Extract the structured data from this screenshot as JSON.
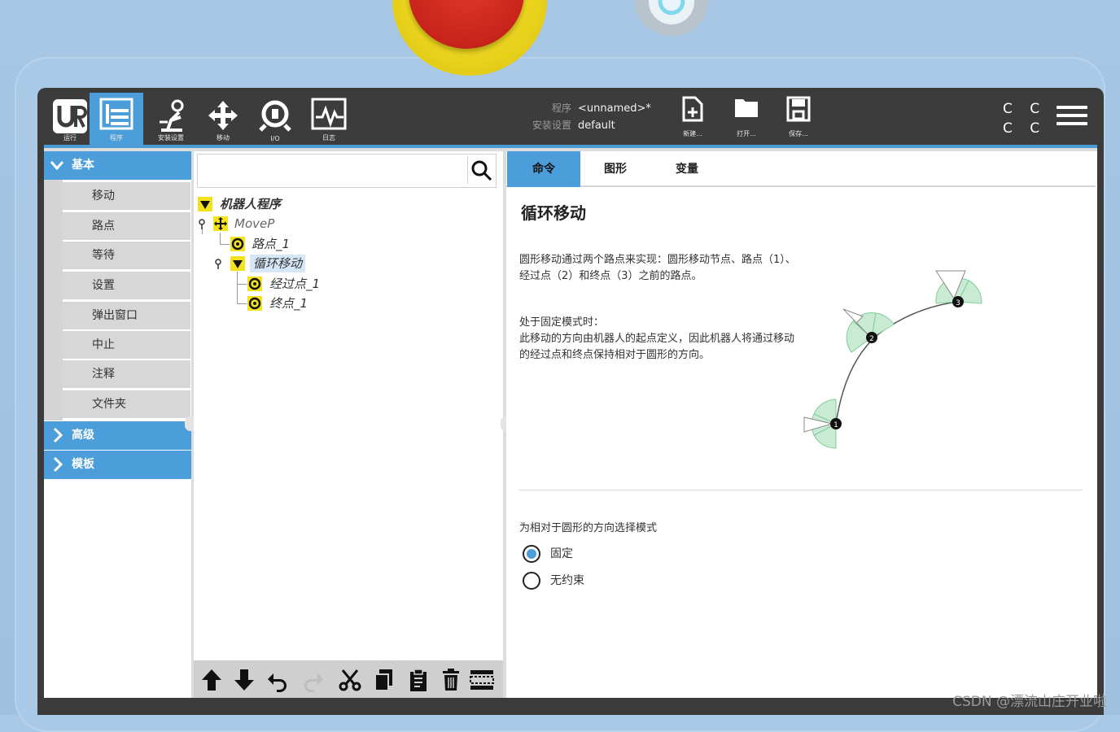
{
  "topbar": {
    "buttons": [
      {
        "label": "运行",
        "icon": "ur-logo-icon"
      },
      {
        "label": "程序",
        "icon": "program-icon"
      },
      {
        "label": "安装设置",
        "icon": "installation-icon"
      },
      {
        "label": "移动",
        "icon": "move-icon"
      },
      {
        "label": "I/O",
        "icon": "io-icon"
      },
      {
        "label": "日志",
        "icon": "log-icon"
      }
    ],
    "program_key": "程序",
    "program_value": "<unnamed>*",
    "installation_key": "安装设置",
    "installation_value": "default",
    "new_label": "新建...",
    "open_label": "打开...",
    "save_label": "保存...",
    "cc_text": "C C",
    "cc_text2": "C C"
  },
  "leftnav": {
    "basic_label": "基本",
    "items": [
      "移动",
      "路点",
      "等待",
      "设置",
      "弹出窗口",
      "中止",
      "注释",
      "文件夹"
    ],
    "advanced_label": "高级",
    "templates_label": "模板"
  },
  "tree": {
    "root": "机器人程序",
    "movep": "MoveP",
    "waypoint1": "路点_1",
    "circle": "循环移动",
    "via": "经过点_1",
    "end": "终点_1"
  },
  "tabs": [
    "命令",
    "图形",
    "变量"
  ],
  "command": {
    "title": "循环移动",
    "para1": "圆形移动通过两个路点来实现：圆形移动节点、路点（1）、经过点（2）和终点（3）之前的路点。",
    "para2_head": "处于固定模式时：",
    "para2": "此移动的方向由机器人的起点定义，因此机器人将通过移动的经过点和终点保持相对于圆形的方向。",
    "diagram_labels": [
      "1",
      "2",
      "3"
    ],
    "mode_question": "为相对于圆形的方向选择模式",
    "option_fixed": "固定",
    "option_free": "无约束",
    "selected": "固定"
  },
  "watermark": "CSDN @漂流山庄开业啦",
  "colors": {
    "accent": "#4b9ed9",
    "topbar": "#3c3c3c",
    "tree_icon": "#f3e21e"
  }
}
